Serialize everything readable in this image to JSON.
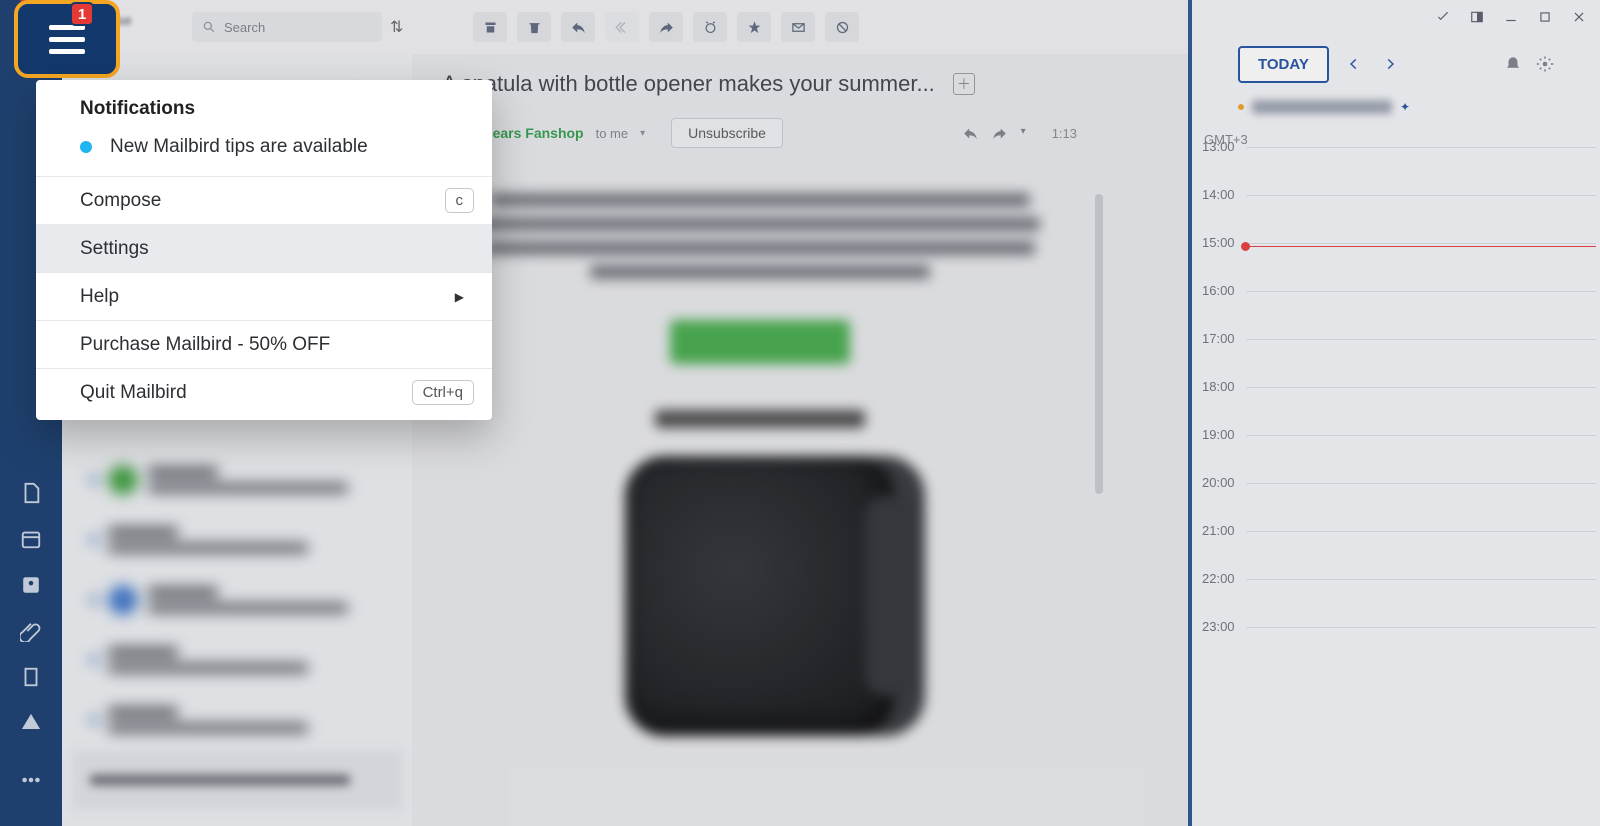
{
  "hamburger": {
    "badge": "1"
  },
  "topbar": {
    "compose_label": "Compose",
    "search_placeholder": "Search"
  },
  "subject": "A spatula with bottle opener makes your summer...",
  "message": {
    "sender_partial": "icago Bears Fanshop",
    "to": "to me",
    "unsubscribe": "Unsubscribe",
    "time": "1:13"
  },
  "popup": {
    "notifications_title": "Notifications",
    "notification_item": "New Mailbird tips are available",
    "items": [
      {
        "label": "Compose",
        "shortcut": "c",
        "hovered": false,
        "submenu": false
      },
      {
        "label": "Settings",
        "shortcut": "",
        "hovered": true,
        "submenu": false
      },
      {
        "label": "Help",
        "shortcut": "",
        "hovered": false,
        "submenu": true
      },
      {
        "label": "Purchase Mailbird - 50% OFF",
        "shortcut": "",
        "hovered": false,
        "submenu": false
      },
      {
        "label": "Quit Mailbird",
        "shortcut": "Ctrl+q",
        "hovered": false,
        "submenu": false
      }
    ]
  },
  "calendar": {
    "today": "TODAY",
    "tz": "GMT+3",
    "hours": [
      "13:00",
      "14:00",
      "15:00",
      "16:00",
      "17:00",
      "18:00",
      "19:00",
      "20:00",
      "21:00",
      "22:00",
      "23:00"
    ],
    "now_hour_index": 2
  }
}
